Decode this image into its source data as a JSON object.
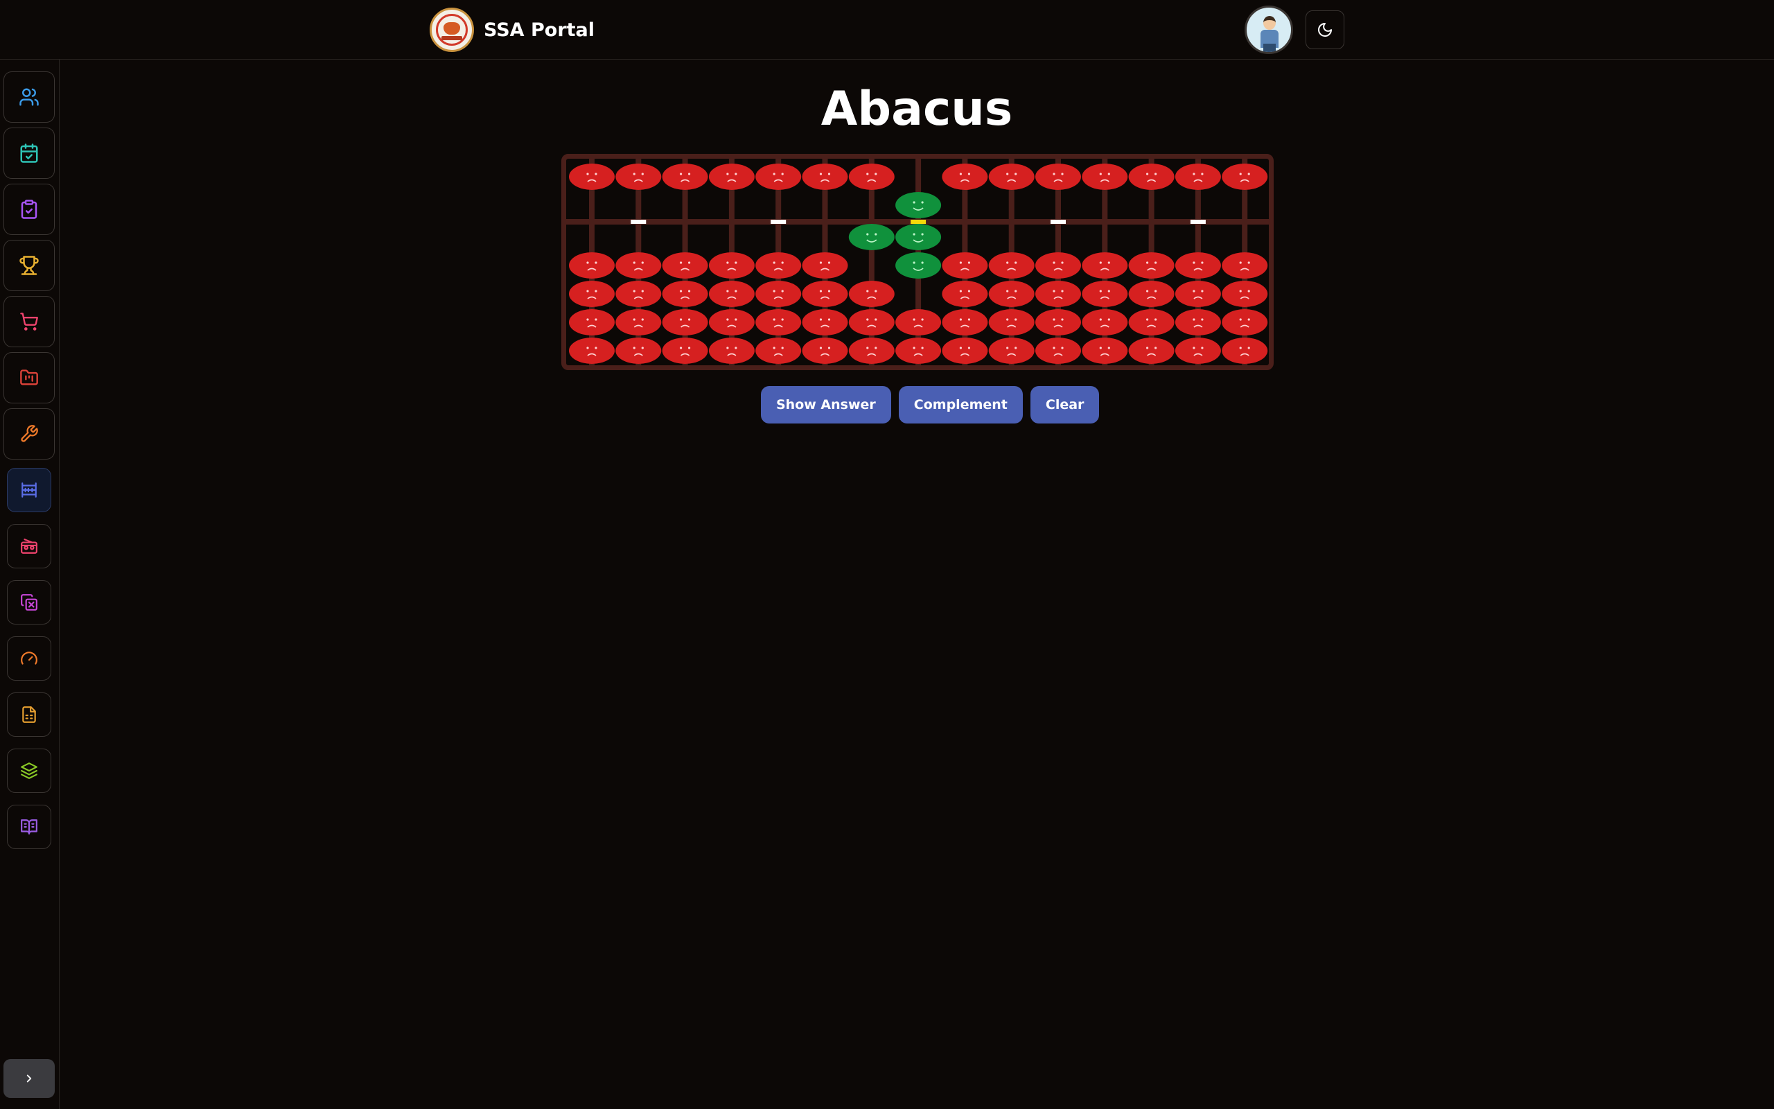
{
  "header": {
    "brand_title": "SSA Portal",
    "logo_icon": "ssa-logo-icon",
    "avatar_icon": "user-avatar-icon",
    "theme_toggle_icon": "moon-icon"
  },
  "sidebar": {
    "items": [
      {
        "name": "users",
        "icon": "users-icon",
        "color": "#3b9be8"
      },
      {
        "name": "calendar",
        "icon": "calendar-check-icon",
        "color": "#2ec4b6"
      },
      {
        "name": "tasks",
        "icon": "clipboard-check-icon",
        "color": "#a855f7"
      },
      {
        "name": "achievements",
        "icon": "trophy-icon",
        "color": "#e8b030"
      },
      {
        "name": "shop",
        "icon": "shopping-cart-icon",
        "color": "#f0436e"
      },
      {
        "name": "folders",
        "icon": "folder-chart-icon",
        "color": "#e0433a"
      },
      {
        "name": "tools",
        "icon": "wrench-icon",
        "color": "#f07a2a"
      },
      {
        "name": "abacus",
        "icon": "abacus-icon",
        "color": "#5b6ee8",
        "active": true
      },
      {
        "name": "radio",
        "icon": "radio-icon",
        "color": "#f0436e"
      },
      {
        "name": "flashcards",
        "icon": "copy-x-icon",
        "color": "#c846d8"
      },
      {
        "name": "speed",
        "icon": "gauge-icon",
        "color": "#f07a2a"
      },
      {
        "name": "worksheets",
        "icon": "file-spreadsheet-icon",
        "color": "#e8a030"
      },
      {
        "name": "levels",
        "icon": "layers-icon",
        "color": "#8ac926"
      },
      {
        "name": "reading",
        "icon": "book-open-text-icon",
        "color": "#9b5de5"
      }
    ],
    "expand_icon": "chevron-right-icon"
  },
  "main": {
    "title": "Abacus"
  },
  "abacus": {
    "rods": 15,
    "upper_beads_active": [
      false,
      false,
      false,
      false,
      false,
      false,
      false,
      true,
      false,
      false,
      false,
      false,
      false,
      false,
      false
    ],
    "lower_beads_active": [
      0,
      0,
      0,
      0,
      0,
      0,
      1,
      2,
      0,
      0,
      0,
      0,
      0,
      0,
      0
    ],
    "unit_marker_rods": [
      1,
      4,
      10,
      13
    ],
    "active_unit_rod": 7,
    "colors": {
      "frame": "#4a1f1a",
      "bead_inactive": "#d62020",
      "bead_active": "#10913c",
      "marker": "#ffffff",
      "active_marker": "#f5d90a"
    }
  },
  "actions": {
    "show_answer": "Show Answer",
    "complement": "Complement",
    "clear": "Clear"
  }
}
